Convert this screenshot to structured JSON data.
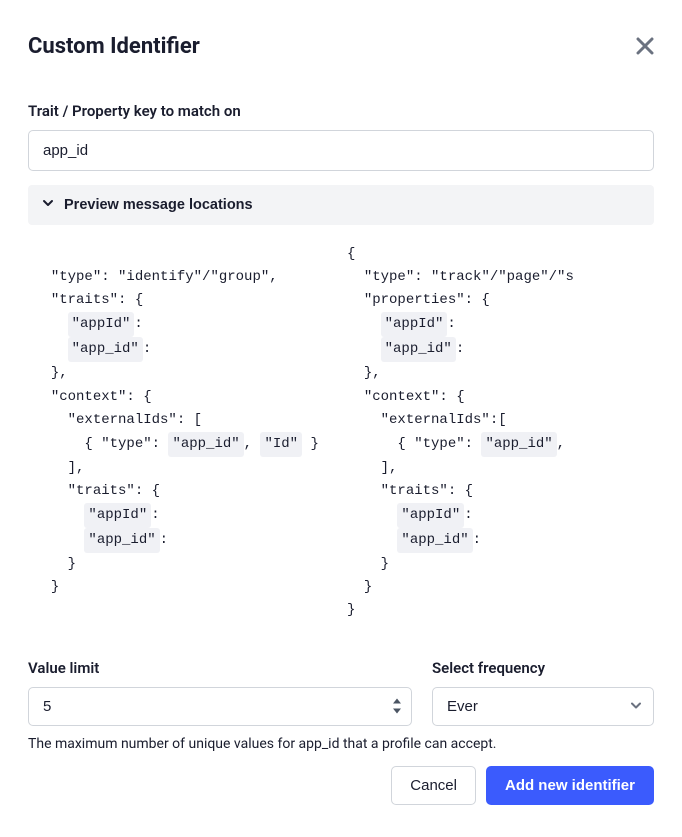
{
  "modal": {
    "title": "Custom Identifier",
    "trait_label": "Trait / Property key to match on",
    "trait_value": "app_id",
    "preview_toggle": "Preview message locations",
    "value_limit_label": "Value limit",
    "value_limit": "5",
    "frequency_label": "Select frequency",
    "frequency_value": "Ever",
    "helper_text": "The maximum number of unique values for app_id that a profile can accept.",
    "cancel_label": "Cancel",
    "submit_label": "Add new identifier"
  },
  "code": {
    "left": {
      "type_key": "\"type\": ",
      "type_val": "\"identify\"/\"group\",",
      "traits_open": "\"traits\": {",
      "app_id_camel": "\"appId\"",
      "app_id_snake": "\"app_id\"",
      "close_brace_comma": "},",
      "context_open": "\"context\": {",
      "external_ids_open": "\"externalIds\": [",
      "type_brace": "{ \"type\": ",
      "comma": ", ",
      "id_token": "\"Id\"",
      "close_curly_space": " }",
      "close_bracket_comma": "],",
      "traits2_open": "\"traits\": {",
      "close_brace": "}"
    },
    "right": {
      "open_brace": "{",
      "type_key": "\"type\": ",
      "type_val": "\"track\"/\"page\"/\"s",
      "properties_open": "\"properties\": {",
      "app_id_camel": "\"appId\"",
      "app_id_snake": "\"app_id\"",
      "close_brace_comma": "},",
      "context_open": "\"context\": {",
      "external_ids_open": "\"externalIds\":[",
      "type_brace": "{ \"type\": ",
      "comma": ",",
      "close_bracket_comma": "],",
      "traits2_open": "\"traits\": {",
      "close_brace": "}"
    }
  }
}
